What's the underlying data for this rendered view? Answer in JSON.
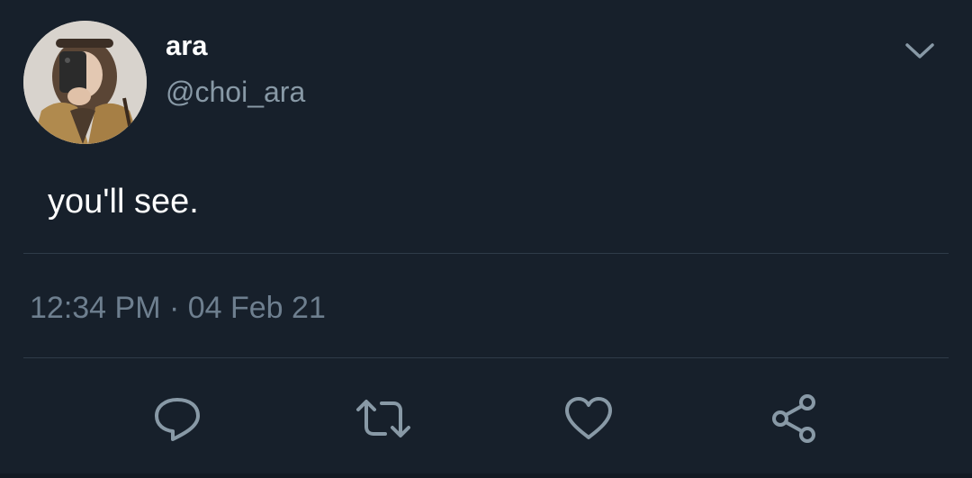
{
  "user": {
    "display_name": "ara",
    "handle": "@choi_ara"
  },
  "tweet": {
    "text": "you'll see.",
    "timestamp": "12:34 PM · 04 Feb 21"
  },
  "icons": {
    "menu": "chevron-down-icon",
    "reply": "reply-icon",
    "retweet": "retweet-icon",
    "like": "heart-icon",
    "share": "share-icon"
  },
  "colors": {
    "background": "#17202b",
    "primary_text": "#ffffff",
    "secondary_text": "#8899a6",
    "icon": "#8899a6",
    "divider": "#2f3b48"
  }
}
